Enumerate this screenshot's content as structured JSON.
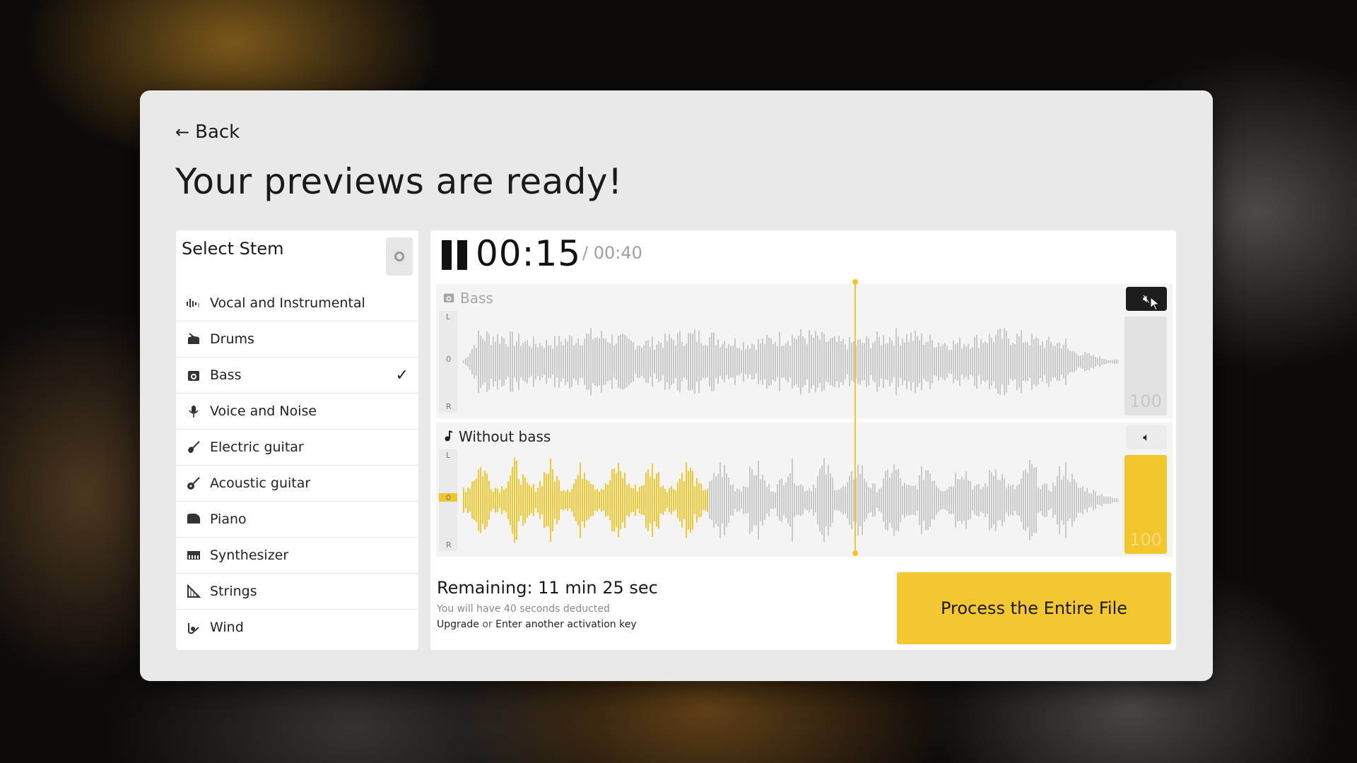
{
  "nav": {
    "back_label": "Back"
  },
  "heading": "Your previews are ready!",
  "stems": {
    "title": "Select Stem",
    "items": [
      {
        "label": "Vocal and Instrumental",
        "icon": "waveform-icon",
        "selected": false
      },
      {
        "label": "Drums",
        "icon": "drum-icon",
        "selected": false
      },
      {
        "label": "Bass",
        "icon": "amp-icon",
        "selected": true
      },
      {
        "label": "Voice and Noise",
        "icon": "microphone-icon",
        "selected": false
      },
      {
        "label": "Electric guitar",
        "icon": "electric-guitar-icon",
        "selected": false
      },
      {
        "label": "Acoustic guitar",
        "icon": "acoustic-guitar-icon",
        "selected": false
      },
      {
        "label": "Piano",
        "icon": "piano-icon",
        "selected": false
      },
      {
        "label": "Synthesizer",
        "icon": "synthesizer-icon",
        "selected": false
      },
      {
        "label": "Strings",
        "icon": "harp-icon",
        "selected": false
      },
      {
        "label": "Wind",
        "icon": "wind-instrument-icon",
        "selected": false
      }
    ]
  },
  "player": {
    "current_time": "00:15",
    "total_time": "/ 00:40",
    "tracks": [
      {
        "name": "Bass",
        "icon": "amp-icon",
        "muted": true,
        "volume_text": "100",
        "ch_l": "L",
        "ch_c": "0",
        "ch_r": "R"
      },
      {
        "name": "Without bass",
        "icon": "note-icon",
        "muted": false,
        "volume_text": "100",
        "ch_l": "L",
        "ch_c": "0",
        "ch_r": "R"
      }
    ],
    "progress": 0.375
  },
  "footer": {
    "remaining": "Remaining: 11 min 25 sec",
    "deduct_note": "You will have 40 seconds deducted",
    "upgrade_link": "Upgrade",
    "or_text": "or",
    "activation_link": "Enter another activation key",
    "process_button": "Process the Entire File"
  },
  "colors": {
    "accent": "#f3c730",
    "waveform_gray": "#c9c9c9",
    "panel_bg": "#e9e9e9"
  }
}
